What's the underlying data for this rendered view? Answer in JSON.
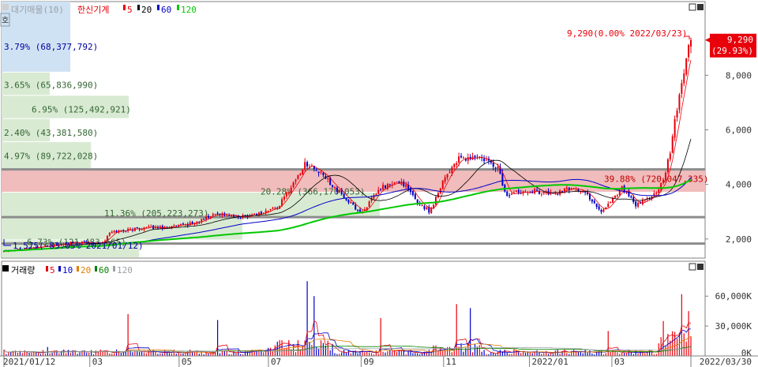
{
  "chart_data": {
    "type": "candlestick",
    "price_legend": {
      "items": [
        {
          "text": "대기매물(10)",
          "color": "#9aa0a6"
        },
        {
          "text": "한신기계",
          "color": "#e8000b"
        },
        {
          "text": "5",
          "color": "#e8000b"
        },
        {
          "text": "20",
          "color": "#000000"
        },
        {
          "text": "60",
          "color": "#0000c8"
        },
        {
          "text": "120",
          "color": "#00c800"
        }
      ]
    },
    "volume_legend": {
      "items": [
        {
          "text": "거래량",
          "color": "#0000c8"
        },
        {
          "text": "5",
          "color": "#e8000b"
        },
        {
          "text": "10",
          "color": "#0000c8"
        },
        {
          "text": "20",
          "color": "#e08000"
        },
        {
          "text": "60",
          "color": "#008000"
        },
        {
          "text": "120",
          "color": "#9aa0a6"
        }
      ]
    },
    "price_axis": {
      "min": 1300,
      "max": 10700,
      "ticks": [
        2000,
        4000,
        6000,
        8000
      ],
      "tick_labels": [
        "2,000",
        "4,000",
        "6,000",
        "8,000"
      ]
    },
    "volume_axis": {
      "min": 0,
      "max": 95000,
      "ticks": [
        0,
        30000,
        60000
      ],
      "tick_labels": [
        "0K",
        "30,000K",
        "60,000K"
      ]
    },
    "x_axis": {
      "labels": [
        "2021/01/12",
        "03",
        "05",
        "07",
        "09",
        "11",
        "2022/01",
        "03",
        "2022/03/30"
      ],
      "positions": [
        0,
        0.125,
        0.255,
        0.385,
        0.52,
        0.64,
        0.765,
        0.885,
        1.0
      ]
    },
    "last_price": {
      "value": 9290,
      "label": "9,290",
      "change": "(29.93%)"
    },
    "max_note": "9,290(0.00% 2022/03/23)",
    "min_note": "1,575(-83.05% 2021/01/12)",
    "supply_bands": [
      {
        "lo": 1300,
        "hi": 1950,
        "ratio": 0.2,
        "label": "6.73% (121,483,665)",
        "label_price": 1900
      },
      {
        "lo": 1950,
        "hi": 2800,
        "ratio": 0.35,
        "label": "11.36% (205,223,273)",
        "label_price": 2950
      },
      {
        "lo": 2800,
        "hi": 3700,
        "ratio": 0.55,
        "label": "20.28% (366,170,053)",
        "label_price": 3750
      },
      {
        "lo": 3700,
        "hi": 4550,
        "ratio": 1.0,
        "label": "39.88% (720,047,335)",
        "label_price": 4200
      },
      {
        "lo": 4550,
        "hi": 5550,
        "ratio": 0.13,
        "label": "4.97% (89,722,028)",
        "label_price": 5050
      },
      {
        "lo": 5550,
        "hi": 6400,
        "ratio": 0.07,
        "label": "2.40% (43,381,580)",
        "label_price": 5900
      },
      {
        "lo": 6400,
        "hi": 7250,
        "ratio": 0.185,
        "label": "6.95% (125,492,921)",
        "label_price": 6750
      },
      {
        "lo": 7250,
        "hi": 8100,
        "ratio": 0.07,
        "label": "3.65% (65,836,990)",
        "label_price": 7650
      },
      {
        "lo": 8100,
        "hi": 10700,
        "ratio": 0.1,
        "label": "3.79% (68,377,792)",
        "label_price": 9050
      }
    ],
    "reference_lines": [
      1830,
      2800,
      4550
    ],
    "anchors": [
      [
        0,
        1575
      ],
      [
        0.05,
        1700
      ],
      [
        0.1,
        1850
      ],
      [
        0.145,
        1880
      ],
      [
        0.155,
        2250
      ],
      [
        0.2,
        2400
      ],
      [
        0.25,
        2450
      ],
      [
        0.28,
        2600
      ],
      [
        0.31,
        2950
      ],
      [
        0.34,
        2800
      ],
      [
        0.375,
        2950
      ],
      [
        0.4,
        3200
      ],
      [
        0.44,
        4800
      ],
      [
        0.47,
        4200
      ],
      [
        0.5,
        3400
      ],
      [
        0.52,
        2950
      ],
      [
        0.55,
        3900
      ],
      [
        0.58,
        4100
      ],
      [
        0.6,
        3400
      ],
      [
        0.62,
        3000
      ],
      [
        0.64,
        4200
      ],
      [
        0.66,
        4900
      ],
      [
        0.69,
        5000
      ],
      [
        0.72,
        4600
      ],
      [
        0.73,
        3600
      ],
      [
        0.76,
        3800
      ],
      [
        0.8,
        3650
      ],
      [
        0.83,
        3900
      ],
      [
        0.85,
        3600
      ],
      [
        0.87,
        3000
      ],
      [
        0.9,
        3900
      ],
      [
        0.92,
        3200
      ],
      [
        0.95,
        3700
      ],
      [
        0.96,
        4100
      ],
      [
        0.97,
        5200
      ],
      [
        0.98,
        6800
      ],
      [
        0.99,
        8200
      ],
      [
        1.0,
        9290
      ]
    ],
    "spike_days": [
      0.065,
      0.18,
      0.31,
      0.44,
      0.45,
      0.55,
      0.66,
      0.68,
      0.88,
      0.96,
      0.985,
      0.995
    ],
    "spike_volumes": [
      9000,
      42000,
      36000,
      75000,
      60000,
      38000,
      52000,
      48000,
      25000,
      35000,
      62000,
      45000
    ]
  }
}
